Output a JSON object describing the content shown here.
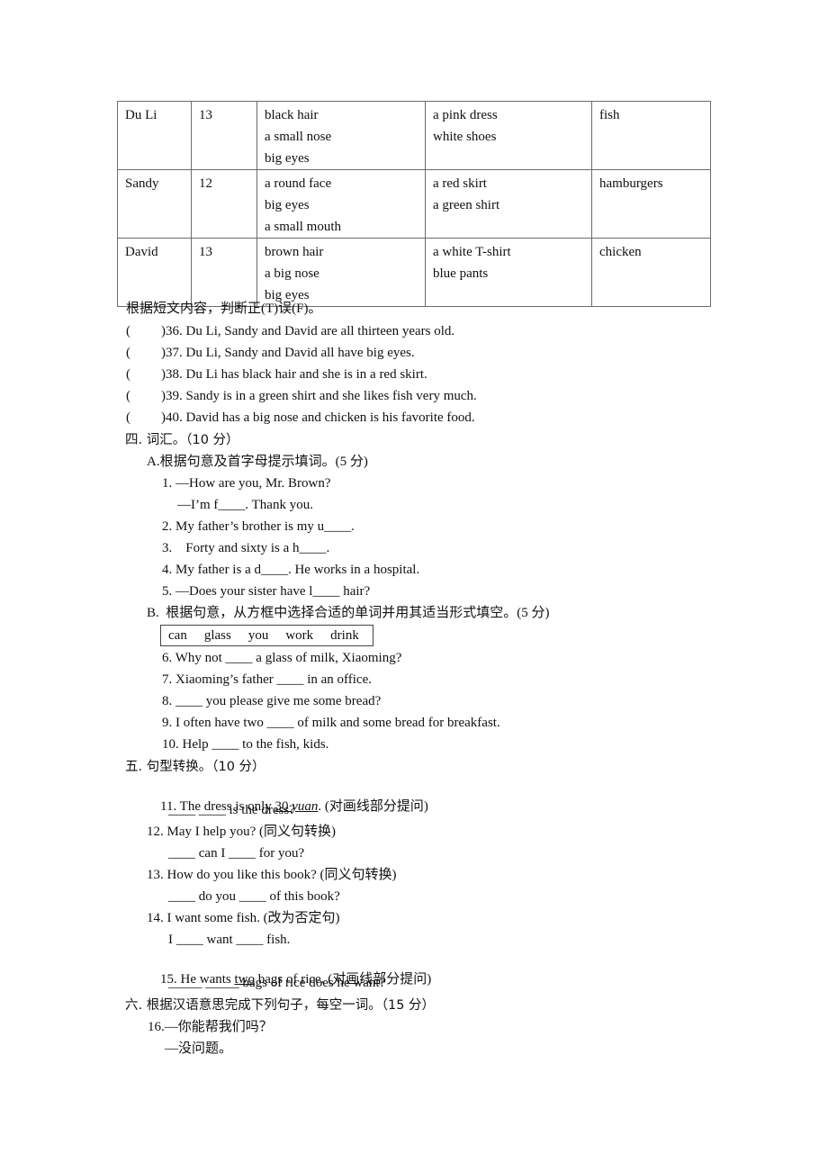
{
  "table": {
    "rows": [
      {
        "name": "Du Li",
        "age": "13",
        "looks": [
          "black hair",
          "a small nose",
          "big eyes"
        ],
        "clothes": [
          "a pink dress",
          "white shoes"
        ],
        "food": "fish"
      },
      {
        "name": "Sandy",
        "age": "12",
        "looks": [
          "a round face",
          "big eyes",
          "a small mouth"
        ],
        "clothes": [
          "a red skirt",
          "a green shirt"
        ],
        "food": "hamburgers"
      },
      {
        "name": "David",
        "age": "13",
        "looks": [
          "brown hair",
          "a big nose",
          "big eyes"
        ],
        "clothes": [
          "a white T-shirt",
          "blue pants"
        ],
        "food": "chicken"
      }
    ]
  },
  "tf_section": {
    "instruction": "根据短文内容，判断正(T)误(F)。",
    "items": [
      {
        "paren_open": "(",
        "text": ")36. Du Li, Sandy and David are all thirteen years old."
      },
      {
        "paren_open": "(",
        "text": ")37. Du Li, Sandy and David all have big eyes."
      },
      {
        "paren_open": "(",
        "text": ")38. Du Li has black hair and she is in a red skirt."
      },
      {
        "paren_open": "(",
        "text": ")39. Sandy is in a green shirt and she likes fish very much."
      },
      {
        "paren_open": "(",
        "text": ")40. David has a big nose and chicken is his favorite food."
      }
    ]
  },
  "section4": {
    "heading": "四. 词汇。（10 分）",
    "partA": {
      "instruction": "A.根据句意及首字母提示填词。(5 分)",
      "lines": [
        "1. —How are you, Mr. Brown?",
        "—I’m f____. Thank you.",
        "2. My father’s brother is my u____.",
        "3.    Forty and sixty is a h____.",
        "4. My father is a d____. He works in a hospital.",
        "5. —Does your sister have l____ hair?"
      ]
    },
    "partB": {
      "instruction": "B.  根据句意，从方框中选择合适的单词并用其适当形式填空。(5 分)",
      "word_box": [
        "can",
        "glass",
        "you",
        "work",
        "drink"
      ],
      "lines": [
        "6. Why not ____ a glass of milk, Xiaoming?",
        "7. Xiaoming’s father ____ in an office.",
        "8. ____ you please give me some bread?",
        "9. I often have two ____ of milk and some bread for breakfast.",
        "10. Help ____ to the fish, kids."
      ]
    }
  },
  "section5": {
    "heading": "五. 句型转换。（10 分）",
    "items": [
      {
        "prefix": "11. The dress is only ",
        "underlined": "30 ",
        "underlined_italic": "yuan",
        "suffix": ". (对画线部分提问)",
        "answer": "____ ____ is the dress?"
      },
      {
        "text": "12. May I help you? (同义句转换)",
        "answer": "____ can I ____ for you?"
      },
      {
        "text": "13. How do you like this book? (同义句转换)",
        "answer": "____ do you ____ of this book?"
      },
      {
        "text": "14. I want some fish. (改为否定句)",
        "answer": "I ____ want ____ fish."
      },
      {
        "prefix": "15. He wants ",
        "underlined": "two",
        "suffix": " bags of rice. (对画线部分提问)",
        "answer": "_____ _____ bags of rice does he want?"
      }
    ]
  },
  "section6": {
    "heading": "六. 根据汉语意思完成下列句子，每空一词。（15 分）",
    "lines": [
      "16.—你能帮我们吗？",
      "—没问题。"
    ]
  }
}
